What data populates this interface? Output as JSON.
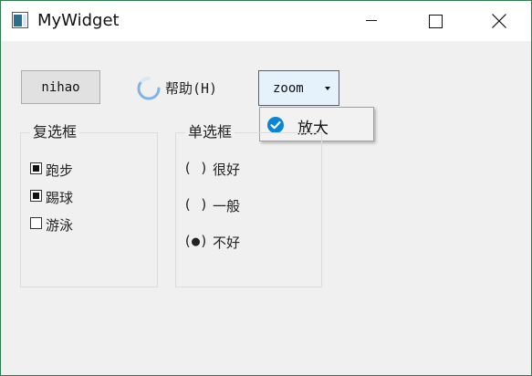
{
  "window": {
    "title": "MyWidget",
    "frame_color": "#2f7d4f",
    "background": "#f0f0f0"
  },
  "toolbar": {
    "nihao_label": "nihao",
    "help_label": "帮助(H)",
    "zoom_value": "zoom"
  },
  "zoom_popup": {
    "items": [
      {
        "label": "放大",
        "checked": true
      }
    ],
    "accent": "#0a84d4"
  },
  "checkbox_group": {
    "title": "复选框",
    "items": [
      {
        "label": "跑步",
        "checked": true
      },
      {
        "label": "踢球",
        "checked": true
      },
      {
        "label": "游泳",
        "checked": false
      }
    ]
  },
  "radio_group": {
    "title": "单选框",
    "items": [
      {
        "mark": "( )",
        "label": "很好",
        "selected": false
      },
      {
        "mark": "( )",
        "label": "一般",
        "selected": false
      },
      {
        "mark": "(●)",
        "label": "不好",
        "selected": true
      }
    ]
  },
  "icons": {
    "app": "app-window-icon",
    "minimize": "minimize-icon",
    "maximize": "maximize-icon",
    "close": "close-icon",
    "help": "loading-spinner-icon",
    "dropdown": "dropdown-arrow-icon",
    "check": "check-circle-icon"
  }
}
